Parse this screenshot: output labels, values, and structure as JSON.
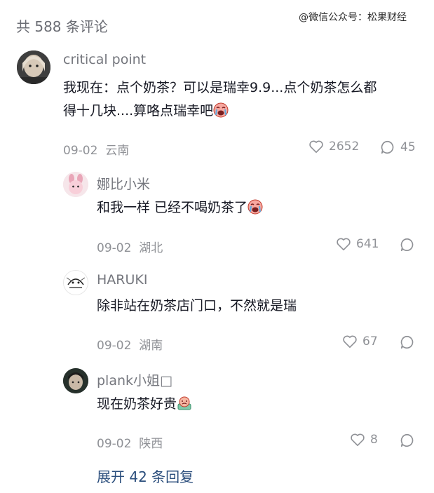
{
  "header": {
    "comment_count": "共 588 条评论"
  },
  "watermark": "@微信公众号：松果财经",
  "comments": [
    {
      "name": "critical point",
      "text_line1": "我现在：点个奶茶？可以是瑞幸9.9...点个奶茶怎么都",
      "text_line2": "得十几块....算咯点瑞幸吧",
      "emoji": "sob-emoji",
      "date": "09-02",
      "location": "云南",
      "likes": "2652",
      "replies": "45"
    }
  ],
  "replies": [
    {
      "name": "娜比小米",
      "text": "和我一样 已经不喝奶茶了",
      "emoji": "sob-emoji",
      "date": "09-02",
      "location": "湖北",
      "likes": "641"
    },
    {
      "name": "HARUKI",
      "text": "除非站在奶茶店门口，不然就是瑞",
      "date": "09-02",
      "location": "湖南",
      "likes": "67"
    },
    {
      "name": "plank小姐□",
      "text": "现在奶茶好贵",
      "emoji": "money-sad-emoji",
      "date": "09-02",
      "location": "陕西",
      "likes": "8"
    }
  ],
  "expand_label": "展开 42 条回复",
  "colors": {
    "text": "#161823",
    "muted": "#8f9196",
    "link": "#2c4f7d"
  }
}
